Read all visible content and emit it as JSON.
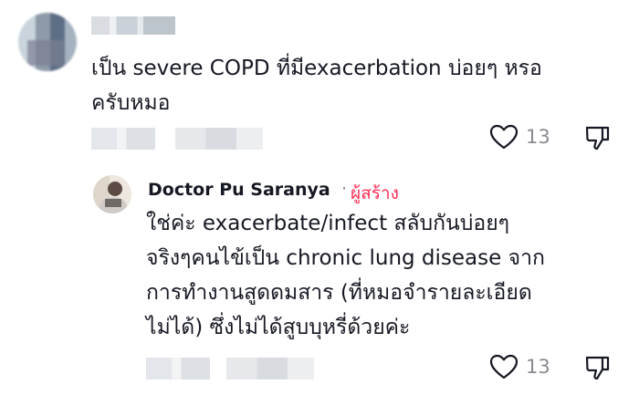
{
  "comment": {
    "text_lines": [
      "เป็น severe COPD ที่มีexacerbation บ่อยๆ หรอ",
      "ครับหมอ"
    ],
    "likes": "13",
    "icons": {
      "like": "heart-outline-icon",
      "dislike": "thumbs-down-icon"
    }
  },
  "reply": {
    "author": "Doctor Pu Saranya",
    "separator": "·",
    "author_badge": "ผู้สร้าง",
    "text_lines": [
      "ใช่ค่ะ exacerbate/infect สลับกันบ่อยๆ",
      "จริงๆคนไข้เป็น chronic lung disease จาก",
      "การทำงานสูดดมสาร (ที่หมอจำรายละเอียด",
      "ไม่ได้) ซึ่งไม่ได้สูบบุหรี่ด้วยค่ะ"
    ],
    "likes": "13",
    "icons": {
      "like": "heart-outline-icon",
      "dislike": "thumbs-down-icon"
    },
    "badge_color": "#fe2c55"
  }
}
